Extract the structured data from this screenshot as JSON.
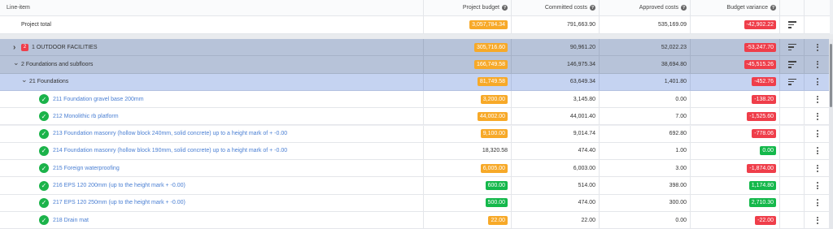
{
  "header": {
    "line_item": "Line-item",
    "project_budget": "Project budget",
    "committed_costs": "Committed costs",
    "approved_costs": "Approved costs",
    "budget_variance": "Budget variance"
  },
  "total": {
    "label": "Project total",
    "budget": "3,057,784.34",
    "committed": "791,663.90",
    "approved": "535,169.09",
    "variance": "-42,902.22"
  },
  "rows": [
    {
      "kind": "group",
      "chevron": ">",
      "count": "2",
      "label": "1 OUTDOOR FACILITIES",
      "budget": "305,716.60",
      "budget_style": "orange",
      "committed": "90,961.20",
      "approved": "52,022.23",
      "variance": "-53,247.70",
      "variance_style": "red"
    },
    {
      "kind": "group",
      "chevron": "v",
      "label": "2 Foundations and subfloors",
      "budget": "166,749.58",
      "budget_style": "orange",
      "committed": "146,975.34",
      "approved": "38,694.80",
      "variance": "-45,515.26",
      "variance_style": "red"
    },
    {
      "kind": "subgroup",
      "chevron": "v",
      "label": "21 Foundations",
      "budget": "81,749.58",
      "budget_style": "orange",
      "committed": "63,649.34",
      "approved": "1,401.80",
      "variance": "-452.76",
      "variance_style": "red"
    },
    {
      "kind": "item",
      "label": "211 Foundation gravel base 200mm",
      "budget": "3,200.00",
      "budget_style": "orange",
      "committed": "3,145.80",
      "approved": "0.00",
      "variance": "-138.20",
      "variance_style": "red"
    },
    {
      "kind": "item",
      "label": "212 Monolithic rb platform",
      "budget": "44,002.00",
      "budget_style": "orange",
      "committed": "44,001.40",
      "approved": "7.00",
      "variance": "-1,525.60",
      "variance_style": "red"
    },
    {
      "kind": "item",
      "label": "213 Foundation masonry (hollow block 240mm, solid concrete) up to a height mark of + -0.00",
      "budget": "9,100.00",
      "budget_style": "orange",
      "committed": "9,014.74",
      "approved": "692.80",
      "variance": "-778.06",
      "variance_style": "red"
    },
    {
      "kind": "item",
      "label": "214 Foundation masonry (hollow block 190mm, solid concrete) up to a height mark of + -0.00",
      "budget": "18,320.58",
      "budget_style": "plain",
      "committed": "474.40",
      "approved": "1.00",
      "variance": "0.00",
      "variance_style": "green"
    },
    {
      "kind": "item",
      "label": "215 Foreign waterproofing",
      "budget": "6,005.00",
      "budget_style": "orange",
      "committed": "6,003.00",
      "approved": "3.00",
      "variance": "-1,874.00",
      "variance_style": "red"
    },
    {
      "kind": "item",
      "label": "216 EPS 120 200mm (up to the height mark + -0.00)",
      "budget": "600.00",
      "budget_style": "green",
      "committed": "514.00",
      "approved": "398.00",
      "variance": "1,174.80",
      "variance_style": "green"
    },
    {
      "kind": "item",
      "label": "217 EPS 120 250mm (up to the height mark + -0.00)",
      "budget": "500.00",
      "budget_style": "green",
      "committed": "474.00",
      "approved": "300.00",
      "variance": "2,710.30",
      "variance_style": "green"
    },
    {
      "kind": "item",
      "label": "218 Drain mat",
      "budget": "22.00",
      "budget_style": "orange",
      "committed": "22.00",
      "approved": "0.00",
      "variance": "-22.00",
      "variance_style": "red"
    }
  ],
  "colors": {
    "orange": "#f7a928",
    "red": "#ef3e4a",
    "green": "#14b84b",
    "group_bg": "#b7c3d9",
    "subgroup_bg": "#c5d3f1",
    "link": "#4a7fd3"
  },
  "icons": {
    "help": "help-circle-icon",
    "sort": "sort-lines-icon",
    "menu": "kebab-menu-icon",
    "check": "check-circle-icon",
    "expand": "chevron-icon"
  }
}
